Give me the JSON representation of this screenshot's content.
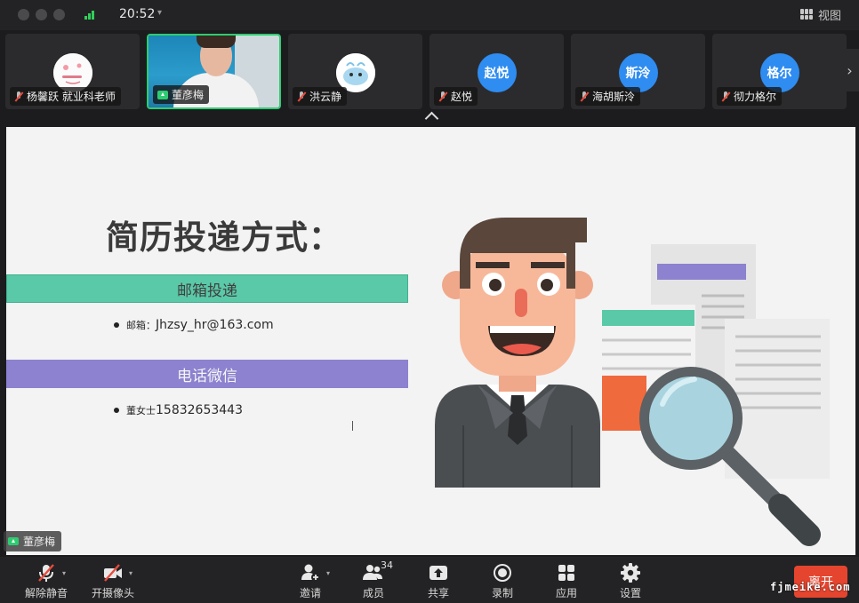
{
  "status_bar": {
    "time": "20:52",
    "view_label": "视图"
  },
  "participants": [
    {
      "name": "杨馨跃 就业科老师",
      "avatar": "image",
      "muted": true
    },
    {
      "name": "董彦梅",
      "avatar": "video",
      "muted": false,
      "sharing": true
    },
    {
      "name": "洪云静",
      "avatar": "image",
      "muted": true
    },
    {
      "name": "赵悦",
      "avatar_text": "赵悦",
      "muted": true
    },
    {
      "name": "海胡斯泠",
      "avatar_text": "斯泠",
      "muted": true
    },
    {
      "name": "彻力格尔",
      "avatar_text": "格尔",
      "muted": true
    }
  ],
  "slide": {
    "title": "简历投递方式：",
    "section1": "邮箱投递",
    "email_label": "邮箱：",
    "email_value": "Jhzsy_hr@163.com",
    "section2": "电话微信",
    "contact_label": "董女士",
    "phone_value": "15832653443"
  },
  "presenter": "董彦梅",
  "toolbar": {
    "unmute": "解除静音",
    "camera": "开摄像头",
    "invite": "邀请",
    "members": "成员",
    "member_count": "34",
    "share": "共享",
    "record": "录制",
    "apps": "应用",
    "settings": "设置",
    "leave": "离开"
  },
  "watermark": "fjmeike.com",
  "colors": {
    "avatar_blue": "#2f8cf0",
    "active_border": "#2ecc71",
    "leave_red": "#e5452f",
    "band_green": "#5ac9a8",
    "band_purple": "#8c82cf"
  }
}
